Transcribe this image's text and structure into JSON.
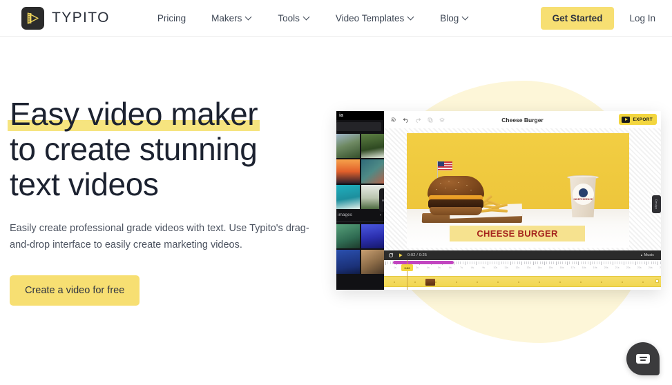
{
  "header": {
    "brand_name": "TYPITO",
    "logo_icon": "film-play-logo-icon",
    "nav": [
      {
        "label": "Pricing",
        "has_chevron": false
      },
      {
        "label": "Makers",
        "has_chevron": true
      },
      {
        "label": "Tools",
        "has_chevron": true
      },
      {
        "label": "Video Templates",
        "has_chevron": true
      },
      {
        "label": "Blog",
        "has_chevron": true
      }
    ],
    "get_started_label": "Get Started",
    "log_in_label": "Log In"
  },
  "hero": {
    "headline_line1": "Easy video maker",
    "headline_line2": "to create stunning",
    "headline_line3": "text videos",
    "subhead": "Easily create professional grade videos with text. Use Typito's drag-and-drop interface to easily create marketing videos.",
    "cta_label": "Create a video for free"
  },
  "editor": {
    "project_title": "Cheese Burger",
    "export_label": "EXPORT",
    "export_icon": "video-export-icon",
    "toolbar_icons": [
      "settings-gear-icon",
      "undo-icon",
      "redo-icon",
      "duplicate-icon",
      "layers-icon"
    ],
    "sidebar": {
      "app_label": "ia",
      "media_label": "images",
      "chevron_icon": "chevron-right-icon",
      "thumbnails": [
        "#6f8a63",
        "#3f5d33",
        "#d9622e",
        "#2f6b7a",
        "#2aa5b5",
        "#cfd6cc",
        "#3b7a58",
        "#2f3bbf",
        "#1d3f8f",
        "#8a6a46"
      ]
    },
    "playbar": {
      "loop_icon": "loop-icon",
      "play_icon": "play-icon",
      "timecode": "0:02 / 0:25",
      "music_label": "Music"
    },
    "timeline": {
      "playhead_label": "0:02",
      "ruler_labels": [
        "1s",
        "2s",
        "3s",
        "4s",
        "5s",
        "6s",
        "7s",
        "8s",
        "9s",
        "10s",
        "11s",
        "12s",
        "13s",
        "14s",
        "15s",
        "16s",
        "17s",
        "18s",
        "19s",
        "20s",
        "21s",
        "22s",
        "23s",
        "24s",
        "25s"
      ]
    },
    "canvas": {
      "caption_text": "CHEESE BURGER",
      "cup_logo_text": "INDEPENDENCE",
      "flag_icon": "usa-flag-icon"
    },
    "right_handle_label": "Design"
  },
  "chat": {
    "icon": "chat-bubble-icon"
  },
  "colors": {
    "accent_yellow": "#f7df72",
    "highlight_yellow": "#f6e47f",
    "blob_yellow": "#fdf6d8",
    "export_yellow": "#f3d63f",
    "text_dark": "#1c2230",
    "text_muted": "#4c5360",
    "caption_red": "#a5231d",
    "clip_magenta": "#c245c0"
  }
}
